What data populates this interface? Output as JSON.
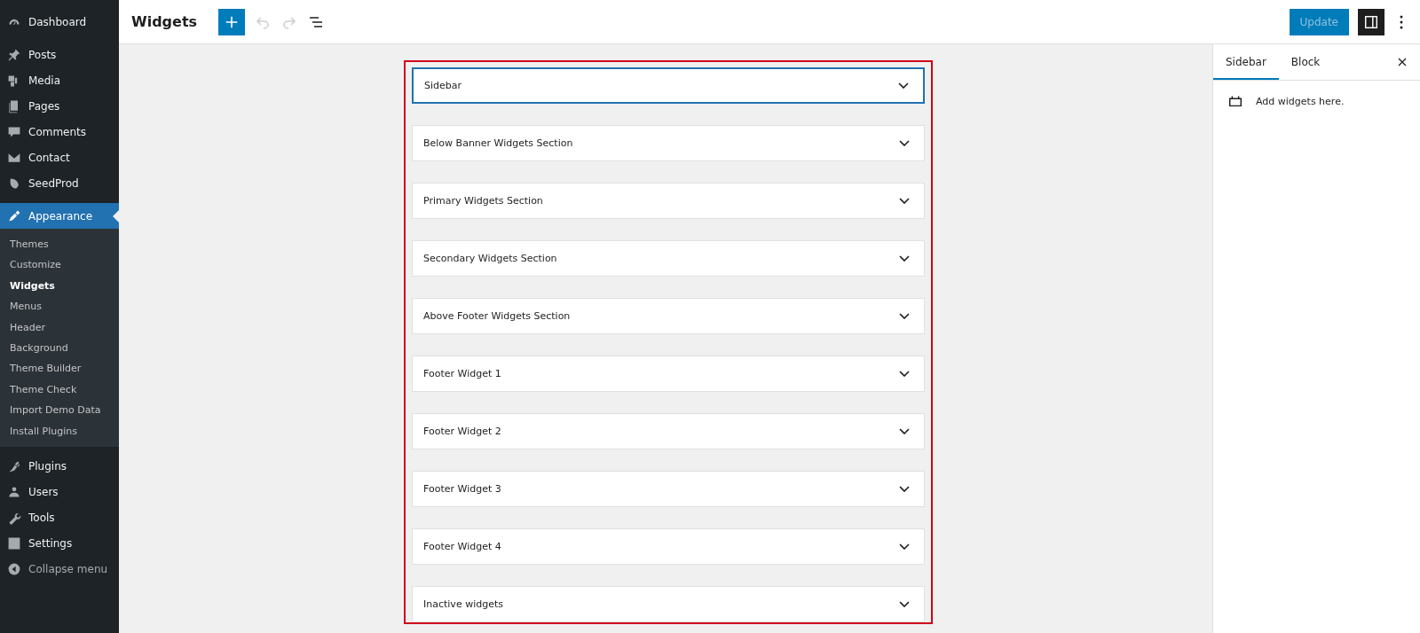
{
  "admin_menu": {
    "items": [
      {
        "label": "Dashboard",
        "current": false
      },
      {
        "label": "Posts",
        "current": false
      },
      {
        "label": "Media",
        "current": false
      },
      {
        "label": "Pages",
        "current": false
      },
      {
        "label": "Comments",
        "current": false
      },
      {
        "label": "Contact",
        "current": false
      },
      {
        "label": "SeedProd",
        "current": false
      },
      {
        "label": "Appearance",
        "current": true,
        "submenu": [
          {
            "label": "Themes",
            "selected": false
          },
          {
            "label": "Customize",
            "selected": false
          },
          {
            "label": "Widgets",
            "selected": true
          },
          {
            "label": "Menus",
            "selected": false
          },
          {
            "label": "Header",
            "selected": false
          },
          {
            "label": "Background",
            "selected": false
          },
          {
            "label": "Theme Builder",
            "selected": false
          },
          {
            "label": "Theme Check",
            "selected": false
          },
          {
            "label": "Import Demo Data",
            "selected": false
          },
          {
            "label": "Install Plugins",
            "selected": false
          }
        ]
      },
      {
        "label": "Plugins",
        "current": false
      },
      {
        "label": "Users",
        "current": false
      },
      {
        "label": "Tools",
        "current": false
      },
      {
        "label": "Settings",
        "current": false
      }
    ],
    "collapse": "Collapse menu"
  },
  "header": {
    "title": "Widgets",
    "update_button": {
      "label": "Update",
      "disabled": true
    },
    "settings_toggle": {
      "on": true
    }
  },
  "widget_areas": [
    {
      "title": "Sidebar",
      "selected": true
    },
    {
      "title": "Below Banner Widgets Section",
      "selected": false
    },
    {
      "title": "Primary Widgets Section",
      "selected": false
    },
    {
      "title": "Secondary Widgets Section",
      "selected": false
    },
    {
      "title": "Above Footer Widgets Section",
      "selected": false
    },
    {
      "title": "Footer Widget 1",
      "selected": false
    },
    {
      "title": "Footer Widget 2",
      "selected": false
    },
    {
      "title": "Footer Widget 3",
      "selected": false
    },
    {
      "title": "Footer Widget 4",
      "selected": false
    },
    {
      "title": "Inactive widgets",
      "selected": false
    }
  ],
  "settings_panel": {
    "tabs": [
      {
        "label": "Sidebar",
        "selected": true
      },
      {
        "label": "Block",
        "selected": false
      }
    ],
    "description": "Add widgets here."
  }
}
